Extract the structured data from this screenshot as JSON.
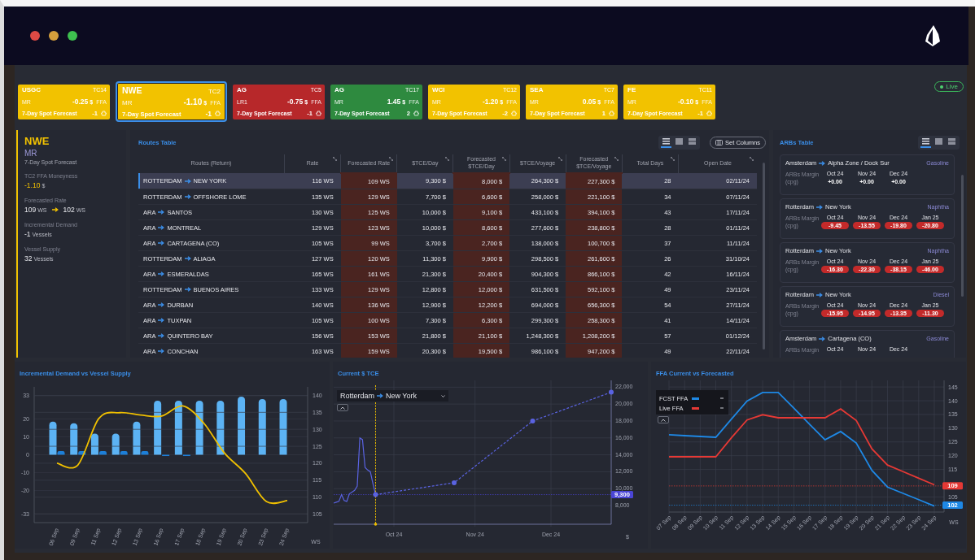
{
  "status": {
    "label": "Live"
  },
  "regions": [
    {
      "region": "USGC",
      "class": "MR",
      "route": "TC14",
      "value": "-0.25",
      "unit": "$",
      "ffa": "FFA",
      "forecast": "7-Day Spot Forecast",
      "change": "-1",
      "color": "#f2c200",
      "selected": false
    },
    {
      "region": "NWE",
      "class": "MR",
      "route": "TC2",
      "value": "-1.10",
      "unit": "$",
      "ffa": "FFA",
      "forecast": "7-Day Spot Forecast",
      "change": "-1",
      "color": "#f2c200",
      "selected": true
    },
    {
      "region": "AG",
      "class": "LR1",
      "route": "TC5",
      "value": "-0.75",
      "unit": "$",
      "ffa": "FFA",
      "forecast": "7-Day Spot Forecast",
      "change": "-1",
      "color": "#b7282a",
      "selected": false
    },
    {
      "region": "AG",
      "class": "MR",
      "route": "TC17",
      "value": "1.45",
      "unit": "$",
      "ffa": "FFA",
      "forecast": "7-Day Spot Forecast",
      "change": "2",
      "color": "#2e8a3f",
      "selected": false
    },
    {
      "region": "WCI",
      "class": "MR",
      "route": "TC12",
      "value": "-1.20",
      "unit": "$",
      "ffa": "FFA",
      "forecast": "7-Day Spot Forecast",
      "change": "-2",
      "color": "#f2c200",
      "selected": false
    },
    {
      "region": "SEA",
      "class": "MR",
      "route": "TC7",
      "value": "0.05",
      "unit": "$",
      "ffa": "FFA",
      "forecast": "7-Day Spot Forecast",
      "change": "1",
      "color": "#f2c200",
      "selected": false
    },
    {
      "region": "FE",
      "class": "MR",
      "route": "TC11",
      "value": "-0.10",
      "unit": "$",
      "ffa": "FFA",
      "forecast": "7-Day Spot Forecast",
      "change": "-1",
      "color": "#f2c200",
      "selected": false
    }
  ],
  "summary": {
    "region": "NWE",
    "class": "MR",
    "subtitle": "7-Day Spot Forecast",
    "metrics": [
      {
        "kind": "moneyness",
        "label": "TC2 FFA Moneyness",
        "value": "-1.10",
        "unit": "$"
      },
      {
        "kind": "range",
        "label": "Forecasted Rate",
        "from": "109",
        "from_unit": "WS",
        "to": "102",
        "to_unit": "WS"
      },
      {
        "kind": "count",
        "label": "Incremental Demand",
        "value": "-1",
        "unit": "Vessels"
      },
      {
        "kind": "count",
        "label": "Vessel Supply",
        "value": "32",
        "unit": "Vessels"
      }
    ]
  },
  "routes_table": {
    "title": "Routes Table",
    "views": [
      {
        "kind": "list",
        "selected": true
      },
      {
        "kind": "grid",
        "selected": false
      },
      {
        "kind": "rows",
        "selected": false
      }
    ],
    "set_columns": "Set Columns",
    "columns": [
      {
        "label": "Routes (Return)",
        "kind": "route",
        "highlighted": false
      },
      {
        "label": "Rate",
        "kind": "number",
        "highlighted": false
      },
      {
        "label": "Forecasted Rate",
        "kind": "number",
        "highlighted": true
      },
      {
        "label": "$TCE/Day",
        "kind": "number",
        "highlighted": false
      },
      {
        "label": "Forecasted $TCE/Day",
        "kind": "number",
        "highlighted": true
      },
      {
        "label": "$TCE/Voyage",
        "kind": "number",
        "highlighted": false
      },
      {
        "label": "Forecasted $TCE/Voyage",
        "kind": "number",
        "highlighted": true
      },
      {
        "label": "Total Days",
        "kind": "number",
        "highlighted": false
      },
      {
        "label": "Open Date",
        "kind": "number",
        "highlighted": false
      }
    ],
    "rows": [
      {
        "cells": [
          {
            "from": "ROTTERDAM",
            "to": "NEW YORK"
          },
          "116 WS",
          "109 WS",
          "9,300 $",
          "8,000 $",
          "264,300 $",
          "227,300 $",
          "28",
          "02/11/24"
        ],
        "selected": true
      },
      {
        "cells": [
          {
            "from": "ROTTERDAM",
            "to": "OFFSHORE LOME"
          },
          "135 WS",
          "129 WS",
          "7,700 $",
          "6,600 $",
          "258,000 $",
          "221,100 $",
          "34",
          "07/11/24"
        ],
        "selected": false
      },
      {
        "cells": [
          {
            "from": "ARA",
            "to": "SANTOS"
          },
          "130 WS",
          "125 WS",
          "10,000 $",
          "9,100 $",
          "433,100 $",
          "394,100 $",
          "43",
          "17/11/24"
        ],
        "selected": false
      },
      {
        "cells": [
          {
            "from": "ARA",
            "to": "MONTREAL"
          },
          "129 WS",
          "123 WS",
          "10,000 $",
          "8,600 $",
          "277,600 $",
          "238,800 $",
          "28",
          "01/11/24"
        ],
        "selected": false
      },
      {
        "cells": [
          {
            "from": "ARA",
            "to": "CARTAGENA (CO)"
          },
          "105 WS",
          "99 WS",
          "3,700 $",
          "2,700 $",
          "138,000 $",
          "100,700 $",
          "37",
          "11/11/24"
        ],
        "selected": false
      },
      {
        "cells": [
          {
            "from": "ROTTERDAM",
            "to": "ALIAGA"
          },
          "127 WS",
          "120 WS",
          "11,300 $",
          "9,900 $",
          "298,500 $",
          "261,600 $",
          "26",
          "31/10/24"
        ],
        "selected": false
      },
      {
        "cells": [
          {
            "from": "ARA",
            "to": "ESMERALDAS"
          },
          "165 WS",
          "161 WS",
          "21,300 $",
          "20,400 $",
          "904,300 $",
          "866,100 $",
          "42",
          "16/11/24"
        ],
        "selected": false
      },
      {
        "cells": [
          {
            "from": "ROTTERDAM",
            "to": "BUENOS AIRES"
          },
          "133 WS",
          "129 WS",
          "12,800 $",
          "12,000 $",
          "631,500 $",
          "592,100 $",
          "49",
          "23/11/24"
        ],
        "selected": false
      },
      {
        "cells": [
          {
            "from": "ARA",
            "to": "DURBAN"
          },
          "140 WS",
          "136 WS",
          "12,900 $",
          "12,200 $",
          "694,000 $",
          "656,300 $",
          "54",
          "27/11/24"
        ],
        "selected": false
      },
      {
        "cells": [
          {
            "from": "ARA",
            "to": "TUXPAN"
          },
          "105 WS",
          "100 WS",
          "7,300 $",
          "6,300 $",
          "299,300 $",
          "258,300 $",
          "41",
          "14/11/24"
        ],
        "selected": false
      },
      {
        "cells": [
          {
            "from": "ARA",
            "to": "QUINTERO BAY"
          },
          "156 WS",
          "153 WS",
          "21,800 $",
          "21,100 $",
          "1,248,300 $",
          "1,208,200 $",
          "57",
          "01/12/24"
        ],
        "selected": false
      },
      {
        "cells": [
          {
            "from": "ARA",
            "to": "CONCHAN"
          },
          "163 WS",
          "159 WS",
          "20,300 $",
          "19,500 $",
          "986,100 $",
          "947,200 $",
          "49",
          "22/11/24"
        ],
        "selected": false
      }
    ]
  },
  "arbs_table": {
    "title": "ARBs Table",
    "views": [
      {
        "kind": "list",
        "selected": true
      },
      {
        "kind": "grid",
        "selected": false
      },
      {
        "kind": "rows",
        "selected": false
      }
    ],
    "cards": [
      {
        "from": "Amsterdam",
        "to": "Alpha Zone / Dock Sur",
        "product": "Gasoline",
        "label": "ARBs Margin (cpg)",
        "months": [
          {
            "month": "Oct 24",
            "value": "+0.00",
            "negative": false
          },
          {
            "month": "Nov 24",
            "value": "+0.00",
            "negative": false
          },
          {
            "month": "Dec 24",
            "value": "+0.00",
            "negative": false
          }
        ]
      },
      {
        "from": "Rotterdam",
        "to": "New York",
        "product": "Naphtha",
        "label": "ARBs Margin (cpg)",
        "months": [
          {
            "month": "Oct 24",
            "value": "-9.45",
            "negative": true
          },
          {
            "month": "Nov 24",
            "value": "-13.55",
            "negative": true
          },
          {
            "month": "Dec 24",
            "value": "-19.80",
            "negative": true
          },
          {
            "month": "Jan 25",
            "value": "-20.80",
            "negative": true
          }
        ]
      },
      {
        "from": "Rotterdam",
        "to": "New York",
        "product": "Naphtha",
        "label": "ARBs Margin (cpg)",
        "months": [
          {
            "month": "Oct 24",
            "value": "-16.30",
            "negative": true
          },
          {
            "month": "Nov 24",
            "value": "-22.30",
            "negative": true
          },
          {
            "month": "Dec 24",
            "value": "-38.15",
            "negative": true
          },
          {
            "month": "Jan 25",
            "value": "-46.00",
            "negative": true
          }
        ]
      },
      {
        "from": "Rotterdam",
        "to": "New York",
        "product": "Diesel",
        "label": "ARBs Margin (cpg)",
        "months": [
          {
            "month": "Oct 24",
            "value": "-15.95",
            "negative": true
          },
          {
            "month": "Nov 24",
            "value": "-14.95",
            "negative": true
          },
          {
            "month": "Dec 24",
            "value": "-13.35",
            "negative": true
          },
          {
            "month": "Jan 25",
            "value": "-11.30",
            "negative": true
          }
        ]
      },
      {
        "from": "Amsterdam",
        "to": "Cartagena (CO)",
        "product": "Gasoline",
        "label": "ARBs Margin",
        "months": [
          {
            "month": "Oct 24"
          },
          {
            "month": "Nov 24"
          },
          {
            "month": "Dec 24"
          }
        ]
      }
    ]
  },
  "charts": [
    {
      "kind": "bar_line",
      "title": "Incremental Demand vs Vessel Supply",
      "chart_data": {
        "type": "bar",
        "categories": [
          "06 Sep",
          "09 Sep",
          "11 Sep",
          "12 Sep",
          "13 Sep",
          "16 Sep",
          "17 Sep",
          "18 Sep",
          "19 Sep",
          "20 Sep",
          "23 Sep",
          "24 Sep"
        ],
        "series": [
          {
            "color": "#5cb3f4",
            "values": [
              18.5,
              17.6,
              11.8,
              11.8,
              18.5,
              30.3,
              30.3,
              30.3,
              30.3,
              32.5,
              31.2,
              31.2
            ]
          },
          {
            "color": "#1d7fd8",
            "values": [
              2.1,
              2.1,
              2.1,
              2.1,
              2.1,
              -0.7,
              -0.7,
              null,
              null,
              null,
              null,
              null
            ]
          }
        ],
        "ylim": [
          -38,
          38
        ],
        "yticks": [
          -33,
          -20,
          -10,
          0,
          10,
          20,
          33
        ],
        "grid": true
      },
      "overlay": {
        "chart_data": {
          "type": "line",
          "categories": [
            null,
            null,
            null,
            null,
            null,
            null,
            null,
            null,
            null,
            null,
            null,
            null
          ],
          "series": [
            {
              "color": "#f0c000",
              "values": [
                120,
                119.5,
                133.2,
                134.9,
                134.2,
                133.9,
                136.9,
                131.9,
                123,
                117,
                108.7,
                109
              ]
            }
          ],
          "ylim": [
            102.5,
            142.5
          ],
          "yticks": [
            105,
            110,
            115,
            120,
            125,
            130,
            135,
            140
          ],
          "ylabel": "WS",
          "grid": true
        }
      }
    },
    {
      "kind": "time_line",
      "title": "Current $ TCE",
      "selector": {
        "from": "Rotterdam",
        "to": "New York"
      },
      "chart_data": {
        "type": "line",
        "categories": [
          null,
          null,
          null,
          null,
          null,
          null,
          null,
          null,
          null,
          null,
          null,
          null,
          null,
          null,
          null,
          null,
          null,
          null,
          null,
          null,
          null,
          null,
          null,
          "Oct 24",
          null,
          null,
          null,
          null,
          null,
          null,
          null,
          null,
          null,
          null,
          null,
          null,
          null,
          null,
          null,
          null,
          null,
          null,
          null,
          null,
          null,
          null,
          null,
          null,
          null,
          null,
          null,
          null,
          null,
          null,
          "Nov 24",
          null,
          null,
          null,
          null,
          null,
          null,
          null,
          null,
          null,
          null,
          null,
          null,
          null,
          null,
          null,
          null,
          null,
          null,
          null,
          null,
          null,
          null,
          null,
          null,
          null,
          null,
          null,
          null,
          "Dec 24",
          null,
          null,
          null,
          null,
          null,
          null,
          null,
          null,
          null,
          null,
          null,
          null,
          null,
          null,
          null,
          null,
          null,
          null,
          null,
          null,
          null,
          null,
          null
        ],
        "series": [
          {
            "color": "#5a63e2",
            "line_style": "solid",
            "values": [
              8300,
              8400,
              8500,
              9300,
              8600,
              8500,
              9400,
              9600,
              9800,
              10300,
              16000,
              15800,
              12500,
              12200,
              12000,
              10600,
              9300,
              null,
              null,
              null,
              null,
              null,
              null,
              null,
              null,
              null,
              null,
              null,
              null,
              null,
              null,
              null,
              null,
              null,
              null,
              null,
              null,
              null,
              null,
              null,
              null,
              null,
              null,
              null,
              null,
              null,
              null,
              null,
              null,
              null,
              null,
              null,
              null,
              null,
              null,
              null,
              null,
              null,
              null,
              null,
              null,
              null,
              null,
              null,
              null,
              null,
              null,
              null,
              null,
              null,
              null,
              null,
              null,
              null,
              null,
              null,
              null,
              null,
              null,
              null,
              null,
              null,
              null,
              null,
              null,
              null,
              null,
              null,
              null,
              null,
              null,
              null,
              null,
              null,
              null,
              null,
              null,
              null,
              null,
              null,
              null,
              null,
              null,
              null,
              null,
              null,
              null
            ]
          },
          {
            "color": "#5a63e2",
            "line_style": "dashed",
            "values": [
              null,
              null,
              null,
              null,
              null,
              null,
              null,
              null,
              null,
              null,
              null,
              null,
              null,
              null,
              null,
              null,
              9300,
              9347,
              9393,
              9440,
              9487,
              9533,
              9580,
              9627,
              9673,
              9720,
              9767,
              9813,
              9860,
              9907,
              9953,
              10000,
              10047,
              10093,
              10140,
              10187,
              10233,
              10280,
              10327,
              10373,
              10420,
              10467,
              10513,
              10560,
              10607,
              10653,
              10700,
              10943,
              11187,
              11430,
              11673,
              11917,
              12160,
              12403,
              12647,
              12890,
              13133,
              13377,
              13620,
              13863,
              14107,
              14350,
              14593,
              14837,
              15080,
              15323,
              15567,
              15810,
              16053,
              16297,
              16540,
              16783,
              17027,
              17270,
              17513,
              17757,
              18000,
              18113,
              18227,
              18340,
              18453,
              18567,
              18680,
              18793,
              18907,
              19020,
              19133,
              19247,
              19360,
              19473,
              19587,
              19700,
              19813,
              19927,
              20040,
              20153,
              20267,
              20380,
              20493,
              20607,
              20720,
              20833,
              20947,
              21060,
              21173,
              21287,
              21400
            ]
          }
        ],
        "ylim": [
          5800,
          22800
        ],
        "yticks": [
          {
            "value": 8000,
            "label": "8,000"
          },
          {
            "value": 10000,
            "label": "10,000"
          },
          {
            "value": 12000,
            "label": "12,000"
          },
          {
            "value": 14000,
            "label": "14,000"
          },
          {
            "value": 16000,
            "label": "16,000"
          },
          {
            "value": 18000,
            "label": "18,000"
          },
          {
            "value": 20000,
            "label": "20,000"
          },
          {
            "value": 22000,
            "label": "22,000"
          }
        ],
        "ylabel": "$",
        "grid": true,
        "ref_lines": [
          {
            "axis": "y",
            "value": 9300,
            "color": "#4a45d6",
            "label": "9,300"
          }
        ]
      }
    },
    {
      "kind": "line",
      "title": "FFA Current vs Forecasted",
      "chart_data": {
        "type": "line",
        "categories": [
          "07 Sep",
          "08 Sep",
          "09 Sep",
          "10 Sep",
          "11 Sep",
          "12 Sep",
          "13 Sep",
          "14 Sep",
          "15 Sep",
          "16 Sep",
          "17 Sep",
          "18 Sep",
          "19 Sep",
          "20 Sep",
          "21 Sep",
          "22 Sep",
          "23 Sep",
          "24 Sep"
        ],
        "series": [
          {
            "name": "FCST FFA",
            "color": "#1e88e5",
            "values": [
              127.6,
              127.3,
              127,
              126.7,
              133.3,
              139.9,
              143,
              143,
              137.3,
              131.5,
              125.8,
              128.8,
              124.6,
              114.7,
              108.6,
              106.3,
              104,
              101.7
            ]
          },
          {
            "name": "Live FFA",
            "color": "#e53935",
            "values": [
              119.6,
              119.6,
              119.6,
              119.6,
              126.5,
              133,
              134.9,
              133.8,
              133.8,
              133.8,
              133.8,
              137,
              132.8,
              122.5,
              116.6,
              114.2,
              111.8,
              109.4
            ]
          }
        ],
        "ylim": [
          99.5,
          147.4
        ],
        "yticks": [
          105,
          115,
          120,
          125,
          130,
          135,
          140,
          145
        ],
        "ylabel": "WS",
        "grid": true,
        "legend": "upper left",
        "ref_lines": [
          {
            "axis": "y",
            "value": 109,
            "color": "#e53935",
            "label": "109"
          },
          {
            "axis": "y",
            "value": 102,
            "color": "#1e88e5",
            "label": "102"
          }
        ]
      }
    }
  ]
}
